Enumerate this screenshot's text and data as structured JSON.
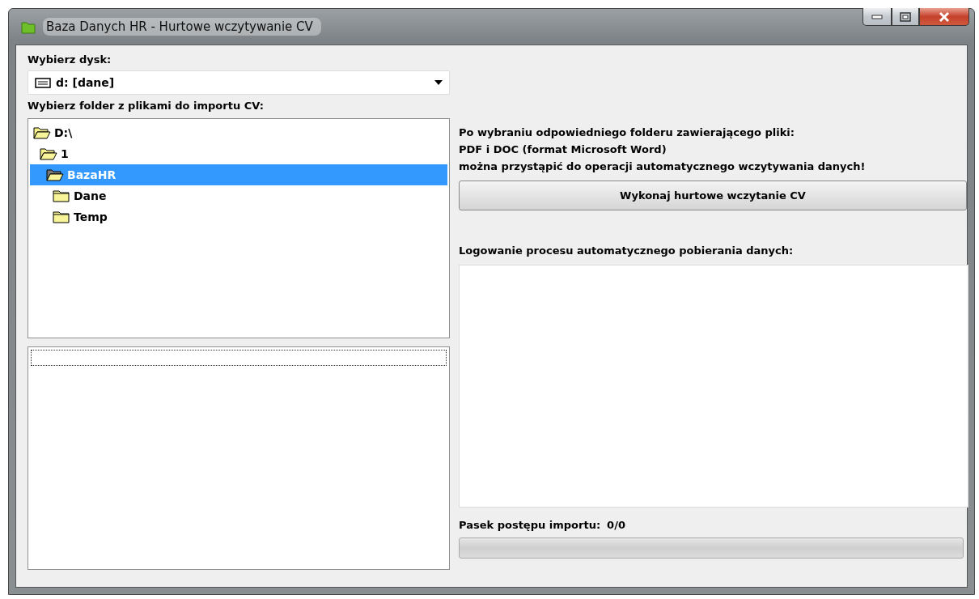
{
  "window": {
    "title": "Baza Danych HR - Hurtowe wczytywanie CV"
  },
  "drive": {
    "label": "Wybierz dysk:",
    "value": "d: [dane]"
  },
  "folders": {
    "label": "Wybierz folder z plikami do importu CV:",
    "tree": [
      {
        "name": "D:\\",
        "expanded": true,
        "selected": false,
        "children": [
          {
            "name": "1",
            "expanded": true,
            "selected": false,
            "children": [
              {
                "name": "BazaHR",
                "expanded": true,
                "selected": true,
                "children": [
                  {
                    "name": "Dane",
                    "expanded": false,
                    "selected": false
                  },
                  {
                    "name": "Temp",
                    "expanded": false,
                    "selected": false
                  }
                ]
              }
            ]
          }
        ]
      }
    ]
  },
  "info": [
    "Po wybraniu odpowiedniego folderu zawierającego pliki:",
    "PDF i DOC (format Microsoft Word)",
    "można przystąpić do operacji automatycznego wczytywania danych!"
  ],
  "import_button": "Wykonaj hurtowe wczytanie CV",
  "log": {
    "label": "Logowanie procesu automatycznego pobierania danych:"
  },
  "progress": {
    "label": "Pasek postępu importu:",
    "count": "0/0",
    "level": 0
  }
}
